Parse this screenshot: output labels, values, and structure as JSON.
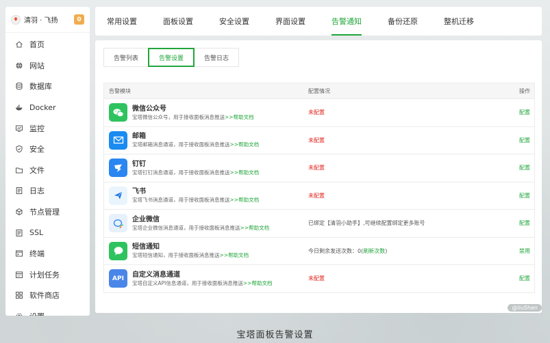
{
  "brand": {
    "name": "清羽 · 飞扬",
    "badge": "0"
  },
  "sidebar": {
    "items": [
      {
        "label": "首页",
        "icon": "home-icon"
      },
      {
        "label": "网站",
        "icon": "globe-icon"
      },
      {
        "label": "数据库",
        "icon": "database-icon"
      },
      {
        "label": "Docker",
        "icon": "docker-icon"
      },
      {
        "label": "监控",
        "icon": "monitor-icon"
      },
      {
        "label": "安全",
        "icon": "shield-icon"
      },
      {
        "label": "文件",
        "icon": "folder-icon"
      },
      {
        "label": "日志",
        "icon": "log-icon"
      },
      {
        "label": "节点管理",
        "icon": "node-icon"
      },
      {
        "label": "SSL",
        "icon": "ssl-icon"
      },
      {
        "label": "终端",
        "icon": "terminal-icon"
      },
      {
        "label": "计划任务",
        "icon": "calendar-icon"
      },
      {
        "label": "软件商店",
        "icon": "grid-icon"
      },
      {
        "label": "设置",
        "icon": "gear-icon"
      }
    ]
  },
  "top_tabs": [
    "常用设置",
    "面板设置",
    "安全设置",
    "界面设置",
    "告警通知",
    "备份还原",
    "整机迁移"
  ],
  "active_top_tab": "告警通知",
  "sub_tabs": [
    "告警列表",
    "告警设置",
    "告警日志"
  ],
  "active_sub_tab": "告警设置",
  "table": {
    "headers": {
      "module": "告警模块",
      "status": "配置情况",
      "action": "操作"
    },
    "rows": [
      {
        "title": "微信公众号",
        "desc": "宝塔微信公众号，用于接收面板消息推送",
        "link": ">>帮助文档",
        "status": "未配置",
        "status_type": "red",
        "action": "配置",
        "icon": "wechat-icon",
        "color": "#2ec35f"
      },
      {
        "title": "邮箱",
        "desc": "宝塔邮箱消息通道，用于接收面板消息推送",
        "link": ">>帮助文档",
        "status": "未配置",
        "status_type": "red",
        "action": "配置",
        "icon": "mail-icon",
        "color": "#1a8bf0"
      },
      {
        "title": "钉钉",
        "desc": "宝塔钉钉消息通道，用于接收面板消息推送",
        "link": ">>帮助文档",
        "status": "未配置",
        "status_type": "red",
        "action": "配置",
        "icon": "dingtalk-icon",
        "color": "#2a86f0"
      },
      {
        "title": "飞书",
        "desc": "宝塔飞书消息通道，用于接收面板消息推送",
        "link": ">>帮助文档",
        "status": "未配置",
        "status_type": "red",
        "action": "配置",
        "icon": "feishu-icon",
        "color": "#eaf4fd"
      },
      {
        "title": "企业微信",
        "desc": "宝塔企业微信消息通道，用于接收面板消息推送",
        "link": ">>帮助文档",
        "status": "已绑定【清羽小助手】,可继续配置绑定更多账号",
        "status_type": "muted",
        "action": "配置",
        "icon": "wecom-icon",
        "color": "#e7f1fb"
      },
      {
        "title": "短信通知",
        "desc": "宝塔短信通知，用于接收面板消息推送",
        "link": ">>帮助文档",
        "status_prefix": "今日剩余发送次数：0(",
        "status_link": "刷新次数",
        "status_suffix": ")",
        "status_type": "sms",
        "action": "禁用",
        "icon": "sms-icon",
        "color": "#2ec35f"
      },
      {
        "title": "自定义消息通道",
        "desc": "宝塔自定义API信息通道，用于接收面板消息推送",
        "link": ">>帮助文档",
        "status": "未配置",
        "status_type": "red",
        "action": "配置",
        "icon": "api-icon",
        "icon_text": "API",
        "color": "#4a86e8"
      }
    ]
  },
  "caption": "宝塔面板告警设置",
  "watermark": "@liuShen"
}
